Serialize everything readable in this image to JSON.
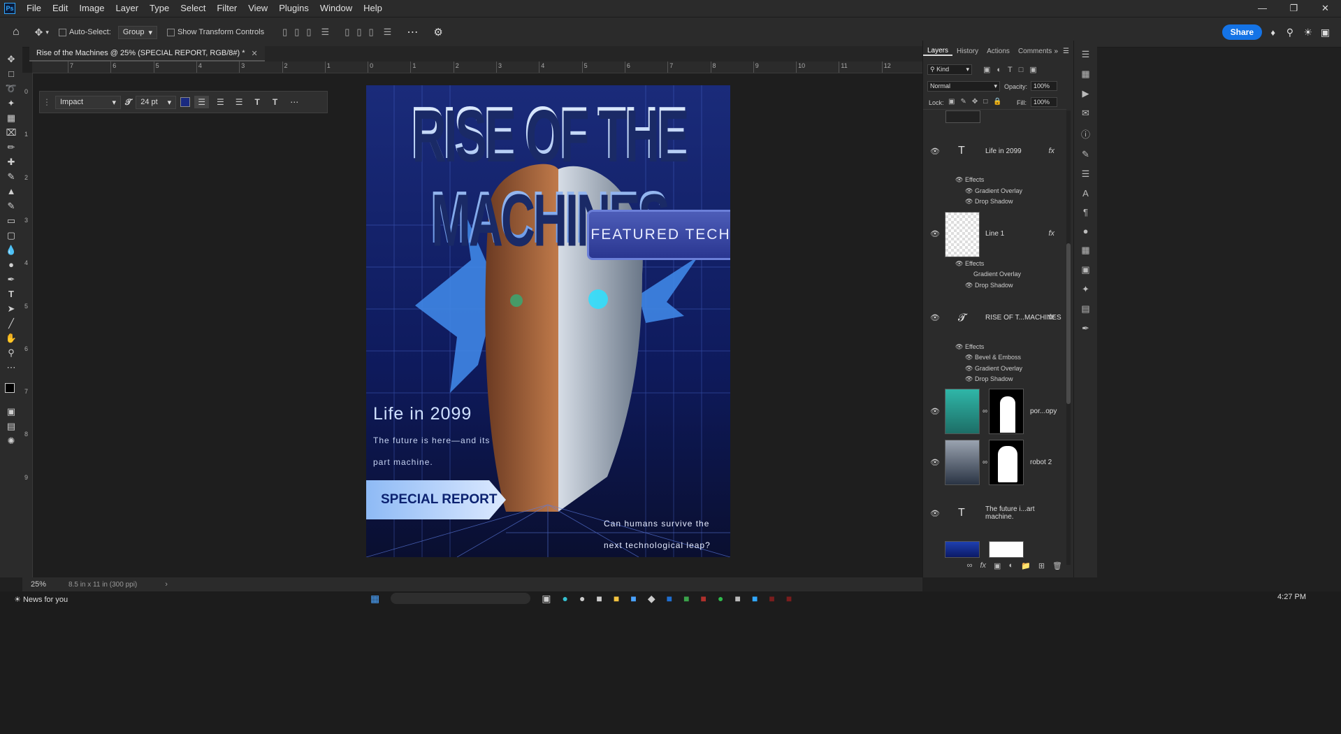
{
  "menubar": {
    "app_logo": "Ps",
    "items": [
      "File",
      "Edit",
      "Image",
      "Layer",
      "Type",
      "Select",
      "Filter",
      "View",
      "Plugins",
      "Window",
      "Help"
    ]
  },
  "options": {
    "auto_select_label": "Auto-Select:",
    "auto_select_value": "Group",
    "transform_label": "Show Transform Controls",
    "share_label": "Share"
  },
  "document": {
    "tab_title": "Rise of the Machines @ 25% (SPECIAL REPORT, RGB/8#) *"
  },
  "ruler": {
    "h_labels": [
      "7",
      "6",
      "5",
      "4",
      "3",
      "2",
      "1",
      "0",
      "1",
      "2",
      "3",
      "4",
      "5",
      "6",
      "7",
      "8",
      "9",
      "10",
      "11",
      "12"
    ],
    "v_labels": [
      "0",
      "1",
      "2",
      "3",
      "4",
      "5",
      "6",
      "7",
      "8",
      "9"
    ]
  },
  "text_toolbar": {
    "font": "Impact",
    "size": "24 pt",
    "color": "#1a2a80"
  },
  "poster": {
    "title": "RISE OF THE MACHINES",
    "featured": "FEATURED TECH",
    "life": "Life in 2099",
    "future": "The future is here—and its part machine.",
    "special": "SPECIAL REPORT",
    "question": "Can humans survive the next technological leap?"
  },
  "layers_panel": {
    "tabs": [
      "Layers",
      "History",
      "Actions",
      "Comments"
    ],
    "filter_label": "Kind",
    "blend_mode": "Normal",
    "opacity_label": "Opacity:",
    "opacity_value": "100%",
    "lock_label": "Lock:",
    "fill_label": "Fill:",
    "fill_value": "100%",
    "layers": [
      {
        "name": "Life in 2099",
        "kind": "text",
        "fx": "fx",
        "effects_label": "Effects",
        "effects": [
          "Gradient Overlay",
          "Drop Shadow"
        ]
      },
      {
        "name": "Line 1",
        "kind": "shape",
        "fx": "fx",
        "effects_label": "Effects",
        "effects": [
          "Gradient Overlay",
          "Drop Shadow"
        ]
      },
      {
        "name": "RISE OF T...MACHINES",
        "kind": "warped-text",
        "fx": "fx",
        "effects_label": "Effects",
        "effects": [
          "Bevel & Emboss",
          "Gradient Overlay",
          "Drop Shadow"
        ]
      },
      {
        "name": "por...opy",
        "kind": "image-mask"
      },
      {
        "name": "robot 2",
        "kind": "image-mask"
      },
      {
        "name": "The future i...art machine.",
        "kind": "text"
      }
    ]
  },
  "status": {
    "zoom": "25%",
    "doc_size": "8.5 in x 11 in (300 ppi)"
  },
  "taskbar": {
    "news": "News for you",
    "time": "4:27 PM"
  }
}
